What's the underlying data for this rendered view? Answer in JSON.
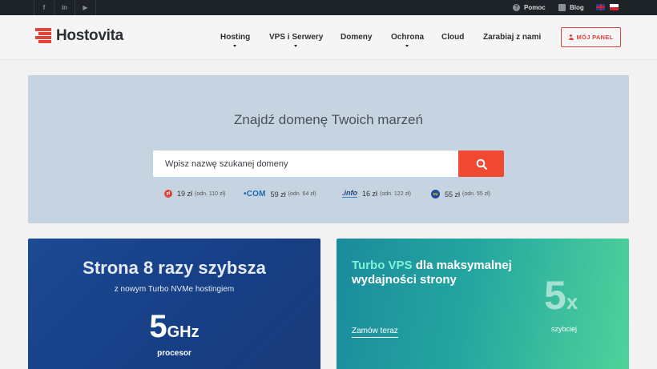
{
  "topbar": {
    "social": [
      {
        "name": "facebook",
        "glyph": "f"
      },
      {
        "name": "linkedin",
        "glyph": "in"
      },
      {
        "name": "youtube",
        "glyph": "▶"
      }
    ],
    "help_label": "Pomoc",
    "blog_label": "Blog",
    "languages": [
      "en",
      "pl"
    ]
  },
  "header": {
    "logo_text": "Hostovita",
    "nav": [
      {
        "label": "Hosting",
        "has_dropdown": true
      },
      {
        "label": "VPS i Serwery",
        "has_dropdown": true
      },
      {
        "label": "Domeny",
        "has_dropdown": false
      },
      {
        "label": "Ochrona",
        "has_dropdown": true
      },
      {
        "label": "Cloud",
        "has_dropdown": false
      },
      {
        "label": "Zarabiaj z nami",
        "has_dropdown": false
      }
    ],
    "panel_button": "MÓJ PANEL"
  },
  "hero": {
    "title": "Znajdź domenę Twoich marzeń",
    "search_placeholder": "Wpisz nazwę szukanej domeny",
    "tlds": [
      {
        "logo": "pl",
        "price": "19 zł",
        "old": "(odn. 110 zł)"
      },
      {
        "logo": "•COM",
        "price": "59 zł",
        "old": "(odn. 64 zł)"
      },
      {
        "logo": ".info",
        "price": "16 zł",
        "old": "(odn. 122 zł)"
      },
      {
        "logo": "eu",
        "price": "55 zł",
        "old": "(odn. 55 zł)"
      }
    ]
  },
  "promo_left": {
    "heading": "Strona 8 razy szybsza",
    "subheading": "z nowym Turbo NVMe hostingiem",
    "big_number": "5",
    "big_unit": "GHz",
    "caption": "procesor"
  },
  "promo_right": {
    "heading_accent": "Turbo VPS",
    "heading_rest": "dla maksymalnej wydajności strony",
    "cta": "Zamów teraz",
    "big_number": "5",
    "big_unit": "x",
    "caption": "szybciej"
  },
  "colors": {
    "topbar": "#1e2328",
    "brand_red": "#e0443a",
    "search_button": "#f04a33",
    "hero_bg": "#c6d4e1",
    "promo_left_bg": "#1c4a94",
    "promo_right_bg_start": "#1b8b9c",
    "promo_right_bg_end": "#4fd39a"
  }
}
